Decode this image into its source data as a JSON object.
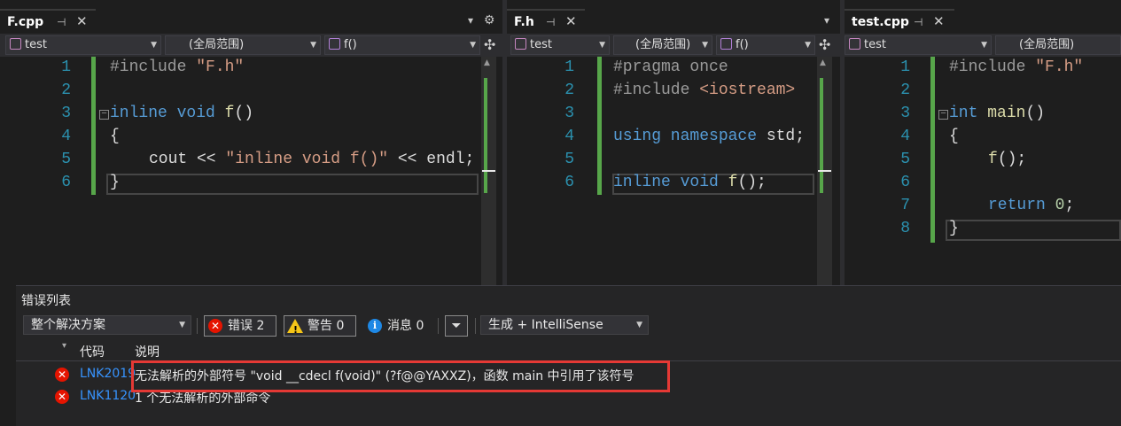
{
  "panes": [
    {
      "tab_title": "F.cpp",
      "nav": {
        "project": "test",
        "scope": "(全局范围)",
        "member": "f()"
      },
      "lines": [
        "1",
        "2",
        "3",
        "4",
        "5",
        "6"
      ]
    },
    {
      "tab_title": "F.h",
      "nav": {
        "project": "test",
        "scope": "(全局范围)",
        "member": "f()"
      },
      "lines": [
        "1",
        "2",
        "3",
        "4",
        "5",
        "6"
      ]
    },
    {
      "tab_title": "test.cpp",
      "nav": {
        "project": "test",
        "scope": "(全局范围)"
      },
      "lines": [
        "1",
        "2",
        "3",
        "4",
        "5",
        "6",
        "7",
        "8"
      ]
    }
  ],
  "code": {
    "fcpp": {
      "l1_pp": "#include ",
      "l1_str": "\"F.h\"",
      "l3_kw": "inline void ",
      "l3_fn": "f",
      "l3_rest": "()",
      "l4": "{",
      "l5_a": "cout << ",
      "l5_str": "\"inline void f()\"",
      "l5_b": " << endl;",
      "l6": "}"
    },
    "fh": {
      "l1": "#pragma once",
      "l2_pp": "#include ",
      "l2_str": "<iostream>",
      "l4_kw": "using namespace ",
      "l4_rest": "std;",
      "l6_kw": "inline void ",
      "l6_fn": "f",
      "l6_rest": "();"
    },
    "testcpp": {
      "l1_pp": "#include ",
      "l1_str": "\"F.h\"",
      "l3_kw": "int ",
      "l3_fn": "main",
      "l3_rest": "()",
      "l4": "{",
      "l5_fn": "f",
      "l5_rest": "();",
      "l7_kw": "return ",
      "l7_num": "0",
      "l7_rest": ";",
      "l8": "}"
    }
  },
  "error_list": {
    "title": "错误列表",
    "scope_filter": "整个解决方案",
    "errors_btn": "错误 2",
    "warnings_btn": "警告 0",
    "messages_btn": "消息 0",
    "source_filter": "生成 + IntelliSense",
    "columns": {
      "code": "代码",
      "description": "说明"
    },
    "rows": [
      {
        "code": "LNK2019",
        "description": "无法解析的外部符号 \"void __cdecl f(void)\" (?f@@YAXXZ)，函数 main 中引用了该符号"
      },
      {
        "code": "LNK1120",
        "description": "1 个无法解析的外部命令"
      }
    ]
  },
  "colors": {
    "accent_green": "#57a64a",
    "error_red": "#e51400",
    "highlight_red": "#e53935"
  },
  "icons": [
    "pin-icon",
    "close-icon",
    "dropdown-icon",
    "gear-icon",
    "split-icon",
    "class-icon",
    "function-icon",
    "error-icon",
    "warning-icon",
    "info-icon",
    "filter-icon"
  ]
}
